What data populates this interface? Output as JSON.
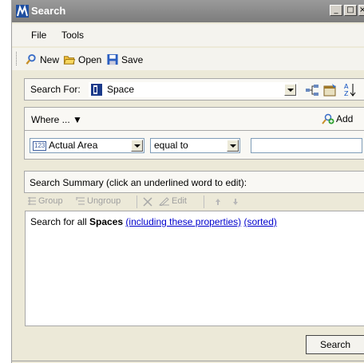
{
  "window": {
    "title": "Search"
  },
  "menu": {
    "items": [
      "File",
      "Tools"
    ]
  },
  "toolbar": {
    "new_label": "New",
    "open_label": "Open",
    "save_label": "Save"
  },
  "search_for": {
    "label": "Search For:",
    "value": "Space"
  },
  "where": {
    "label": "Where ... ▼",
    "add_label": "Add"
  },
  "criteria": {
    "property": "Actual Area",
    "property_badge": "123",
    "operator": "equal to",
    "value": ""
  },
  "summary": {
    "header": "Search Summary (click an underlined word to edit):",
    "tools": {
      "group": "Group",
      "ungroup": "Ungroup",
      "edit": "Edit"
    },
    "text_prefix": "Search for all",
    "text_bold": "Spaces",
    "link_properties": "(including these properties)",
    "link_sorted": "(sorted)"
  },
  "actions": {
    "search_label": "Search"
  },
  "colors": {
    "accent": "#0000cc",
    "titlebar": "#8a8a8a"
  }
}
